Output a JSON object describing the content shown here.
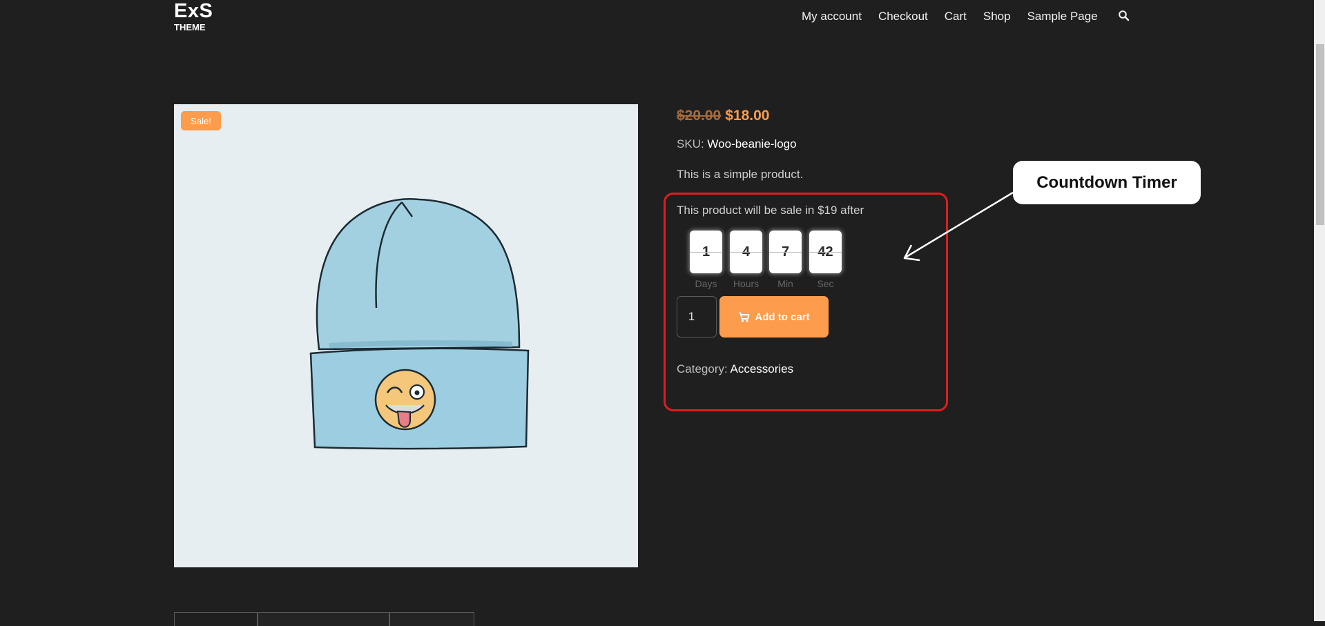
{
  "header": {
    "logo_main": "ExS",
    "logo_sub": "THEME",
    "nav": [
      "My account",
      "Checkout",
      "Cart",
      "Shop",
      "Sample Page"
    ],
    "search_icon": "search-icon"
  },
  "product": {
    "sale_badge": "Sale!",
    "old_price": "$20.00",
    "new_price": "$18.00",
    "sku_label": "SKU:",
    "sku_value": "Woo-beanie-logo",
    "description": "This is a simple product.",
    "sale_note": "This product will be sale in $19 after",
    "countdown": [
      {
        "value": "1",
        "label": "Days"
      },
      {
        "value": "4",
        "label": "Hours"
      },
      {
        "value": "7",
        "label": "Min"
      },
      {
        "value": "42",
        "label": "Sec"
      }
    ],
    "quantity": "1",
    "add_to_cart": "Add to cart",
    "category_label": "Category:",
    "category_value": "Accessories"
  },
  "annotation": {
    "callout": "Countdown Timer",
    "highlight_color": "#e01d1d"
  },
  "colors": {
    "accent": "#fd9c4c",
    "background": "#1f1f1f"
  }
}
